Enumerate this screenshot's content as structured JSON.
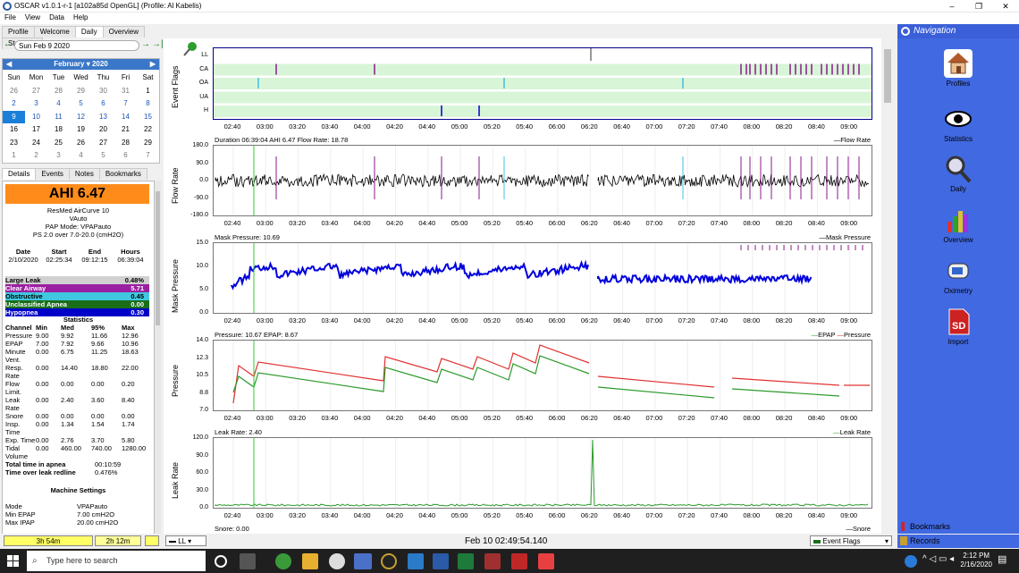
{
  "window": {
    "title": "OSCAR v1.0.1-r-1 [a102a85d OpenGL] (Profile: Al Kabelis)"
  },
  "menu": [
    "File",
    "View",
    "Data",
    "Help"
  ],
  "tabs": [
    "Profile",
    "Welcome",
    "Daily",
    "Overview",
    "Statistics"
  ],
  "date_selector": "Sun Feb 9 2020",
  "calendar": {
    "month": "February",
    "year": "2020",
    "weekdays": [
      "Sun",
      "Mon",
      "Tue",
      "Wed",
      "Thu",
      "Fri",
      "Sat"
    ],
    "rows": [
      [
        "26",
        "27",
        "28",
        "29",
        "30",
        "31",
        "1"
      ],
      [
        "2",
        "3",
        "4",
        "5",
        "6",
        "7",
        "8"
      ],
      [
        "9",
        "10",
        "11",
        "12",
        "13",
        "14",
        "15"
      ],
      [
        "16",
        "17",
        "18",
        "19",
        "20",
        "21",
        "22"
      ],
      [
        "23",
        "24",
        "25",
        "26",
        "27",
        "28",
        "29"
      ],
      [
        "1",
        "2",
        "3",
        "4",
        "5",
        "6",
        "7"
      ]
    ]
  },
  "subtabs": [
    "Details",
    "Events",
    "Notes",
    "Bookmarks"
  ],
  "details": {
    "ahi": "AHI 6.47",
    "machine": "ResMed AirCurve 10",
    "model": "VAuto",
    "pap_mode": "PAP Mode: VPAPauto",
    "ps": "PS 2.0 over 7.0-20.0 (cmH2O)",
    "sess_headers": [
      "Date",
      "Start",
      "End",
      "Hours"
    ],
    "sess_values": [
      "2/10/2020",
      "02:25:34",
      "09:12:15",
      "06:39:04"
    ],
    "events": [
      {
        "name": "Large Leak",
        "value": "0.48%",
        "color": "#d0d0d0",
        "text": "#000"
      },
      {
        "name": "Clear Airway",
        "value": "5.71",
        "color": "#9b1fa1",
        "text": "#fff"
      },
      {
        "name": "Obstructive",
        "value": "0.45",
        "color": "#40c8e0",
        "text": "#000"
      },
      {
        "name": "Unclassified Apnea",
        "value": "0.00",
        "color": "#1a6e1a",
        "text": "#fff"
      },
      {
        "name": "Hypopnea",
        "value": "0.30",
        "color": "#0000c8",
        "text": "#fff"
      }
    ],
    "stats_title": "Statistics",
    "stats_headers": [
      "Channel",
      "Min",
      "Med",
      "95%",
      "Max"
    ],
    "stats": [
      [
        "Pressure",
        "9.00",
        "9.92",
        "11.66",
        "12.96"
      ],
      [
        "EPAP",
        "7.00",
        "7.92",
        "9.66",
        "10.96"
      ],
      [
        "Minute",
        "0.00",
        "6.75",
        "11.25",
        "18.63"
      ],
      [
        "Vent.",
        "",
        "",
        "",
        ""
      ],
      [
        "Resp.",
        "0.00",
        "14.40",
        "18.80",
        "22.00"
      ],
      [
        "Rate",
        "",
        "",
        "",
        ""
      ],
      [
        "Flow",
        "0.00",
        "0.00",
        "0.00",
        "0.20"
      ],
      [
        "Limit.",
        "",
        "",
        "",
        ""
      ],
      [
        "Leak Rate",
        "0.00",
        "2.40",
        "3.60",
        "8.40"
      ],
      [
        "Snore",
        "0.00",
        "0.00",
        "0.00",
        "0.00"
      ],
      [
        "Insp. Time",
        "0.00",
        "1.34",
        "1.54",
        "1.74"
      ],
      [
        "Exp. Time",
        "0.00",
        "2.76",
        "3.70",
        "5.80"
      ],
      [
        "Tidal",
        "0.00",
        "460.00",
        "740.00",
        "1280.00"
      ],
      [
        "Volume",
        "",
        "",
        "",
        ""
      ]
    ],
    "total_apnea_label": "Total time in apnea",
    "total_apnea_value": "00:10:59",
    "leak_redline_label": "Time over leak redline",
    "leak_redline_value": "0.476%",
    "machine_settings_title": "Machine Settings",
    "settings": [
      [
        "Mode",
        "VPAPauto"
      ],
      [
        "Min EPAP",
        "7.00 cmH2O"
      ],
      [
        "Max IPAP",
        "20.00 cmH2O"
      ]
    ]
  },
  "bottom": {
    "time_left": "3h 54m",
    "time_right": "2h 12m",
    "channel_select": "LL",
    "cursor_time": "Feb 10 02:49:54.140",
    "event_flags_select": "Event Flags"
  },
  "graph": {
    "xticks": [
      "02:40",
      "03:00",
      "03:20",
      "03:40",
      "04:00",
      "04:20",
      "04:40",
      "05:00",
      "05:20",
      "05:40",
      "06:00",
      "06:20",
      "06:40",
      "07:00",
      "07:20",
      "07:40",
      "08:00",
      "08:20",
      "08:40",
      "09:00"
    ],
    "event_flags": {
      "label": "Event Flags",
      "rows": [
        "LL",
        "CA",
        "OA",
        "UA",
        "H"
      ]
    },
    "flow": {
      "label": "Flow Rate",
      "title": "Duration 06:39:04 AHI 6.47 Flow Rate: 18.78",
      "legend": "Flow Rate",
      "yticks": [
        "180.0",
        "90.0",
        "0.0",
        "-90.0",
        "-180.0"
      ]
    },
    "mask": {
      "label": "Mask Pressure",
      "title": "Mask Pressure: 10.69",
      "legend": "Mask Pressure",
      "yticks": [
        "15.0",
        "10.0",
        "5.0",
        "0.0"
      ]
    },
    "pressure": {
      "label": "Pressure",
      "title": "Pressure: 10.67 EPAP: 8.67",
      "legend_epap": "EPAP",
      "legend_pressure": "Pressure",
      "yticks": [
        "14.0",
        "12.3",
        "10.5",
        "8.8",
        "7.0"
      ]
    },
    "leak": {
      "label": "Leak Rate",
      "title": "Leak Rate: 2.40",
      "legend": "Leak Rate",
      "yticks": [
        "120.0",
        "90.0",
        "60.0",
        "30.0",
        "0.0"
      ]
    },
    "snore": {
      "title": "Snore: 0.00",
      "legend": "Snore"
    }
  },
  "nav": {
    "title": "Navigation",
    "items": [
      "Profiles",
      "Statistics",
      "Daily",
      "Overview",
      "Oximetry",
      "Import"
    ],
    "bookmarks": "Bookmarks",
    "records": "Records"
  },
  "taskbar": {
    "search": "Type here to search",
    "time": "2:12 PM",
    "date": "2/16/2020"
  }
}
